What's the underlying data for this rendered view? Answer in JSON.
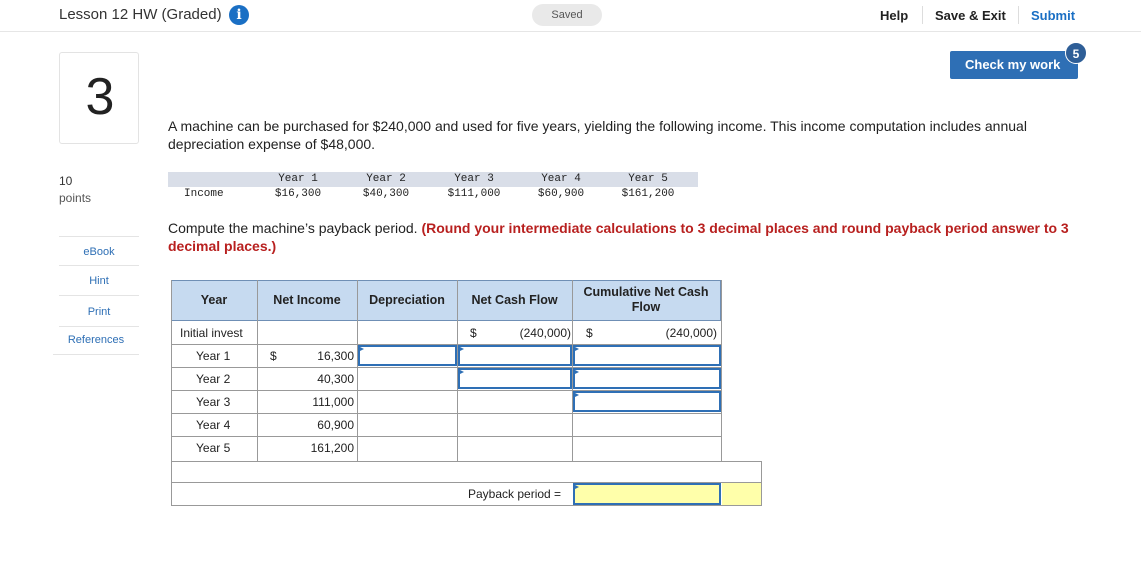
{
  "header": {
    "title": "Lesson 12 HW (Graded)",
    "saved": "Saved",
    "help": "Help",
    "save_exit": "Save & Exit",
    "submit": "Submit",
    "check_my_work": "Check my work",
    "check_badge": "5",
    "info_glyph": "i"
  },
  "question": {
    "number": "3",
    "points_value": "10",
    "points_label": "points",
    "tools": [
      "eBook",
      "Hint",
      "Print",
      "References"
    ],
    "prompt": "A machine can be purchased for $240,000 and used for five years, yielding the following income. This income computation includes annual depreciation expense of $48,000.",
    "compute_text": "Compute the machine’s payback period. ",
    "compute_emphasis": "(Round your intermediate calculations to 3 decimal places and round payback period answer to 3 decimal places.)"
  },
  "income_table": {
    "row_label": "Income",
    "years": [
      "Year 1",
      "Year 2",
      "Year 3",
      "Year 4",
      "Year 5"
    ],
    "values": [
      "$16,300",
      "$40,300",
      "$111,000",
      "$60,900",
      "$161,200"
    ]
  },
  "grid": {
    "headers": {
      "year": "Year",
      "net_income": "Net Income",
      "depreciation": "Depreciation",
      "net_cash_flow": "Net Cash Flow",
      "cumulative": "Cumulative Net Cash Flow"
    },
    "rows": [
      {
        "year": "Initial invest",
        "ni_dollar": "",
        "ni": "",
        "ncf_dollar": "$",
        "ncf": "(240,000)",
        "cum_dollar": "$",
        "cum": "(240,000)"
      },
      {
        "year": "Year 1",
        "ni_dollar": "$",
        "ni": "16,300"
      },
      {
        "year": "Year 2",
        "ni_dollar": "",
        "ni": "40,300"
      },
      {
        "year": "Year 3",
        "ni_dollar": "",
        "ni": "111,000"
      },
      {
        "year": "Year 4",
        "ni_dollar": "",
        "ni": "60,900"
      },
      {
        "year": "Year 5",
        "ni_dollar": "",
        "ni": "161,200"
      }
    ],
    "payback_label": "Payback period ="
  },
  "colors": {
    "accent": "#2e6fb5",
    "header_fill": "#c6daf0",
    "answer_fill": "#ffffaa",
    "emphasis_red": "#b8201f"
  }
}
